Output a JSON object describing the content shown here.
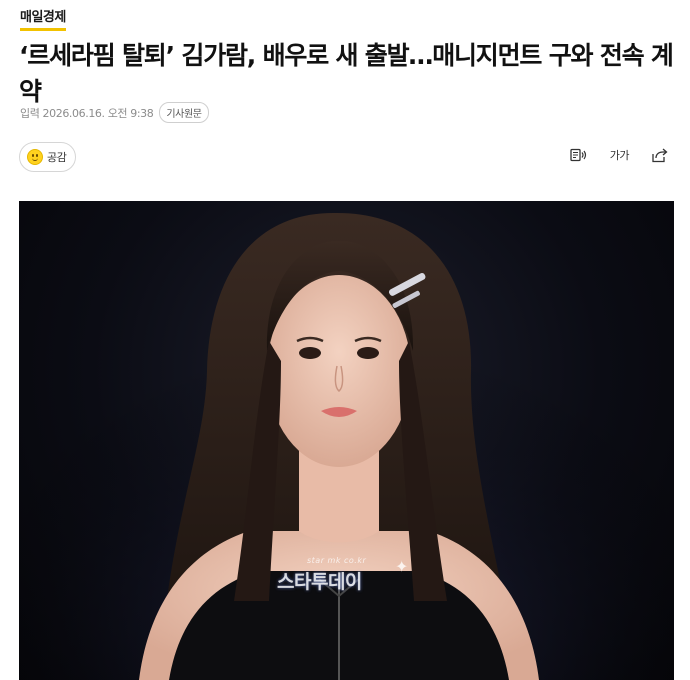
{
  "press": {
    "name": "매일경제"
  },
  "article": {
    "headline": "‘르세라핌 탈퇴’ 김가람, 배우로 새 출발…매니지먼트 구와 전속 계약",
    "published": "입력 2026.06.16. 오전 9:38",
    "origin_label": "기사원문"
  },
  "reaction": {
    "label": "공감",
    "icon": "smile-icon"
  },
  "toolbar": {
    "audio_icon": "text-to-speech-icon",
    "font_icon_label": "가가",
    "share_icon": "share-icon"
  },
  "photo": {
    "watermark": "스타투데이",
    "watermark_sub": "star mk co.kr"
  },
  "colors": {
    "accent": "#f2c200",
    "background": "#ffffff",
    "photo_bg": "#0b0c14"
  }
}
